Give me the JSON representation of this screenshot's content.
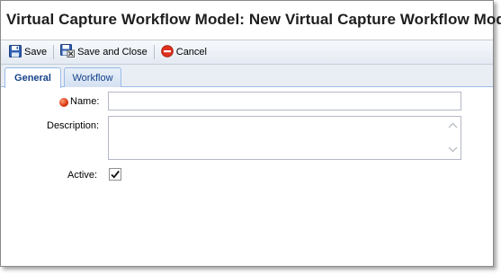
{
  "window": {
    "title": "Virtual Capture Workflow Model: New Virtual Capture Workflow Model"
  },
  "toolbar": {
    "save_label": "Save",
    "save_close_label": "Save and Close",
    "cancel_label": "Cancel"
  },
  "tabs": [
    {
      "label": "General",
      "active": true
    },
    {
      "label": "Workflow",
      "active": false
    }
  ],
  "form": {
    "name_label": "Name:",
    "name_value": "",
    "name_required": true,
    "description_label": "Description:",
    "description_value": "",
    "active_label": "Active:",
    "active_checked": true
  },
  "colors": {
    "tab_text": "#15428b",
    "tab_border": "#99bbe8",
    "required_dot": "#d9360e"
  }
}
